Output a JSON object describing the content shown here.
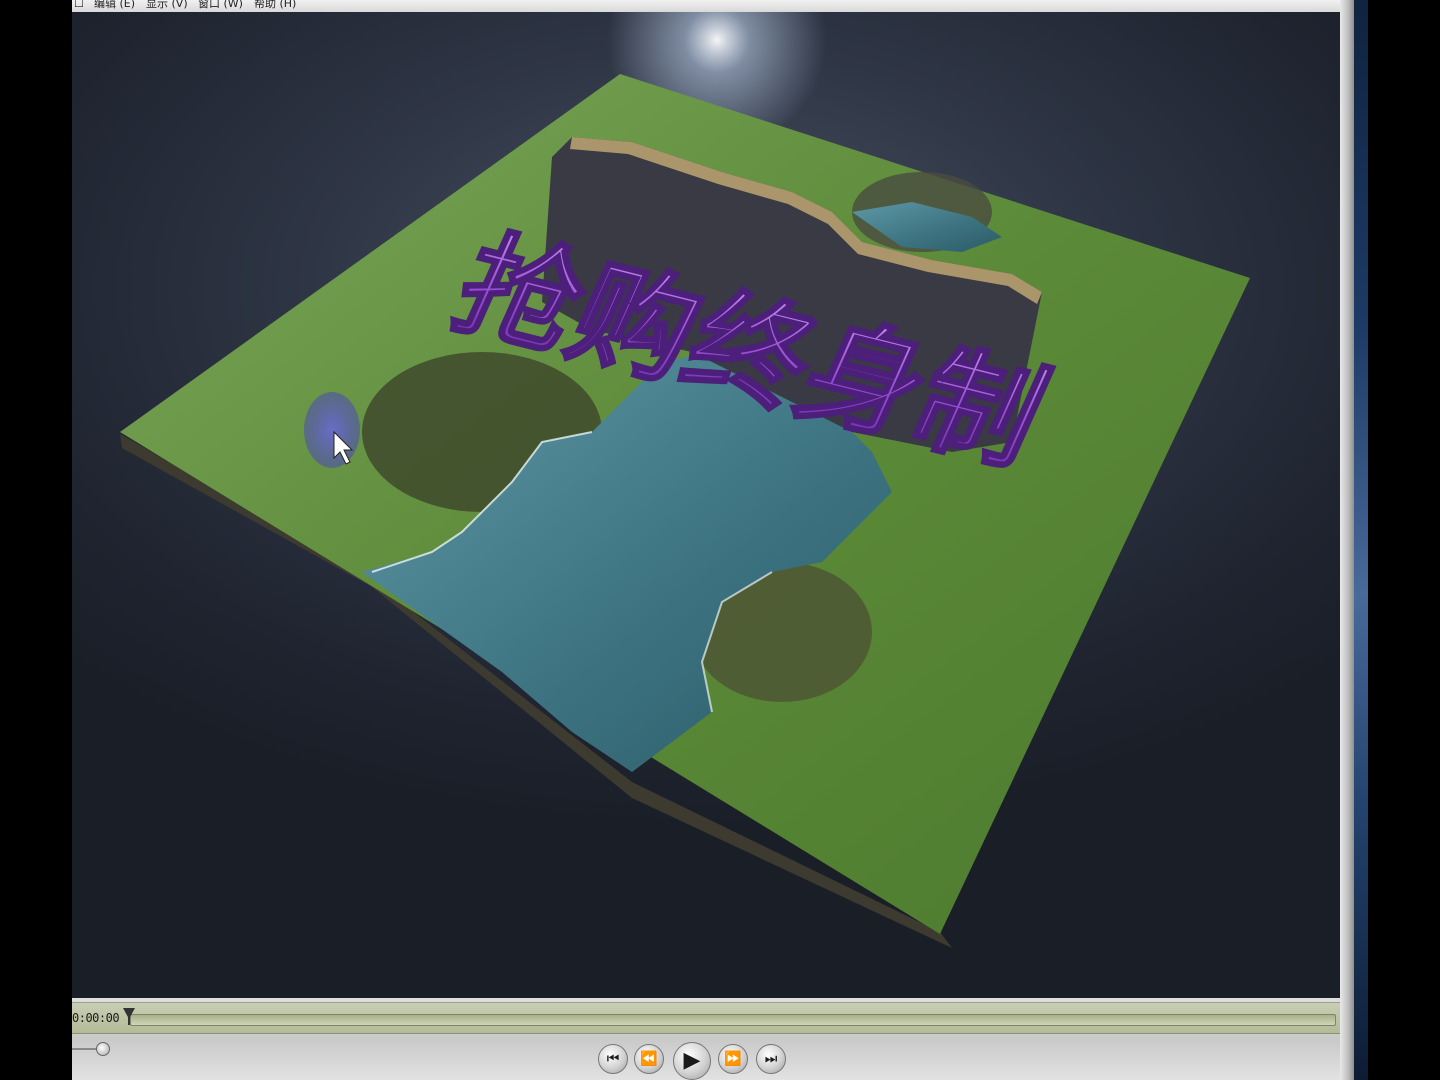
{
  "menu": {
    "items": [
      "编辑 (E)",
      "显示 (V)",
      "窗口 (W)",
      "帮助 (H)"
    ]
  },
  "video": {
    "title_text": "抢购终身制"
  },
  "controls": {
    "timecode": "0:00:00",
    "progress_fraction": 0.0,
    "buttons": {
      "skip_back": "⏮",
      "rewind": "⏪",
      "play": "▶",
      "fast_forward": "⏩",
      "skip_forward": "⏭"
    }
  },
  "colors": {
    "text_purple": "#9b4dd6",
    "text_side": "#3a3a44",
    "grass": "#5e8a3a",
    "water": "#3f7683",
    "timeline": "#b3bb98"
  }
}
